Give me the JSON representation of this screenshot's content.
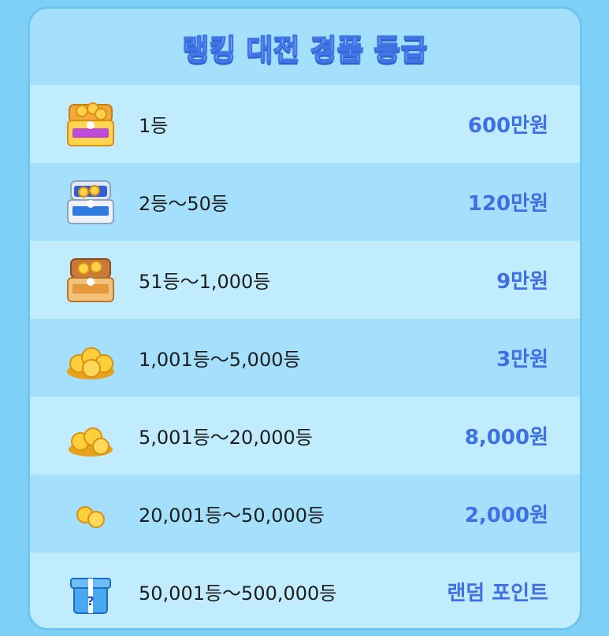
{
  "title": "랭킹 대전 경품 등급",
  "rows": [
    {
      "rank": "1등",
      "prize": "600만원",
      "icon": "purple-treasure-chest-icon"
    },
    {
      "rank": "2등～50등",
      "prize": "120만원",
      "icon": "blue-treasure-chest-icon"
    },
    {
      "rank": "51등～1,000등",
      "prize": "9만원",
      "icon": "orange-treasure-chest-icon"
    },
    {
      "rank": "1,001등～5,000등",
      "prize": "3만원",
      "icon": "coin-pile-large-icon"
    },
    {
      "rank": "5,001등～20,000등",
      "prize": "8,000원",
      "icon": "coin-pile-medium-icon"
    },
    {
      "rank": "20,001등～50,000등",
      "prize": "2,000원",
      "icon": "coin-pile-small-icon"
    },
    {
      "rank": "50,001등～500,000등",
      "prize": "랜덤 포인트",
      "icon": "mystery-gift-box-icon"
    }
  ],
  "colors": {
    "background": "#7fd0f7",
    "row_light": "#c1ecfd",
    "row_dark": "#a4e0fb",
    "prize_text": "#3e6fe4",
    "title_stroke": "#3f74e6"
  }
}
